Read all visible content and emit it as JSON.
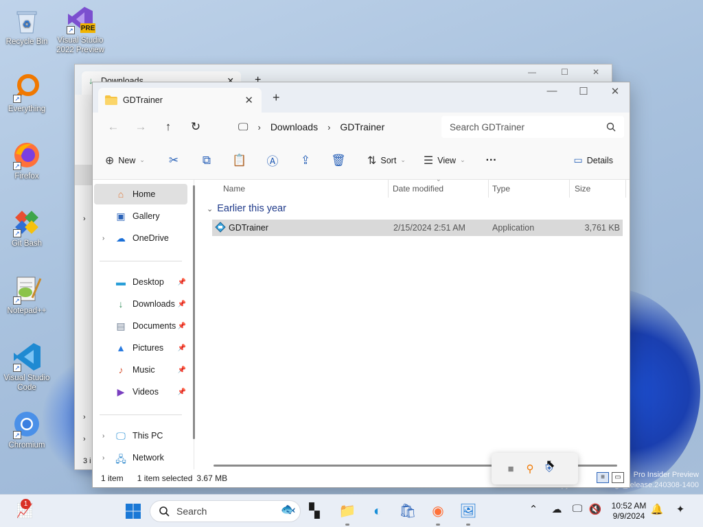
{
  "desktop": {
    "icons": [
      {
        "label": "Recycle Bin"
      },
      {
        "label": "Visual Studio 2022 Preview",
        "badge": "PRE"
      },
      {
        "label": "Everything"
      },
      {
        "label": "Firefox"
      },
      {
        "label": "Git Bash"
      },
      {
        "label": "Notepad++"
      },
      {
        "label": "Visual Studio Code"
      },
      {
        "label": "Chromium"
      }
    ],
    "watermark": {
      "line1": "Pro Insider Preview",
      "line2": "Evaluation copy. Build 26100.ge_release.240308-1400"
    }
  },
  "back_window": {
    "tab_label": "Downloads",
    "left_count": "3 i"
  },
  "window": {
    "tab_label": "GDTrainer",
    "nav": {
      "back": "←",
      "forward": "→",
      "up": "↑",
      "refresh": "↻"
    },
    "breadcrumb": [
      "Downloads",
      "GDTrainer"
    ],
    "search_placeholder": "Search GDTrainer",
    "commands": {
      "new": "New",
      "sort": "Sort",
      "view": "View",
      "more": "···",
      "details": "Details"
    },
    "navpane": {
      "home": "Home",
      "gallery": "Gallery",
      "onedrive": "OneDrive",
      "quick": [
        "Desktop",
        "Downloads",
        "Documents",
        "Pictures",
        "Music",
        "Videos"
      ],
      "this_pc": "This PC",
      "network": "Network"
    },
    "columns": {
      "name": "Name",
      "date": "Date modified",
      "type": "Type",
      "size": "Size"
    },
    "group_label": "Earlier this year",
    "files": [
      {
        "name": "GDTrainer",
        "date": "2/15/2024 2:51 AM",
        "type": "Application",
        "size": "3,761 KB"
      }
    ],
    "status": {
      "count": "1 item",
      "selected": "1 item selected",
      "size": "3.67 MB"
    }
  },
  "taskbar": {
    "search_placeholder": "Search",
    "notification_count": "1",
    "clock_time": "10:52 AM",
    "clock_date": "9/9/2024"
  },
  "colors": {
    "accent": "#2a62b8",
    "selection": "#d9d9d9",
    "group": "#1f3a8a"
  }
}
